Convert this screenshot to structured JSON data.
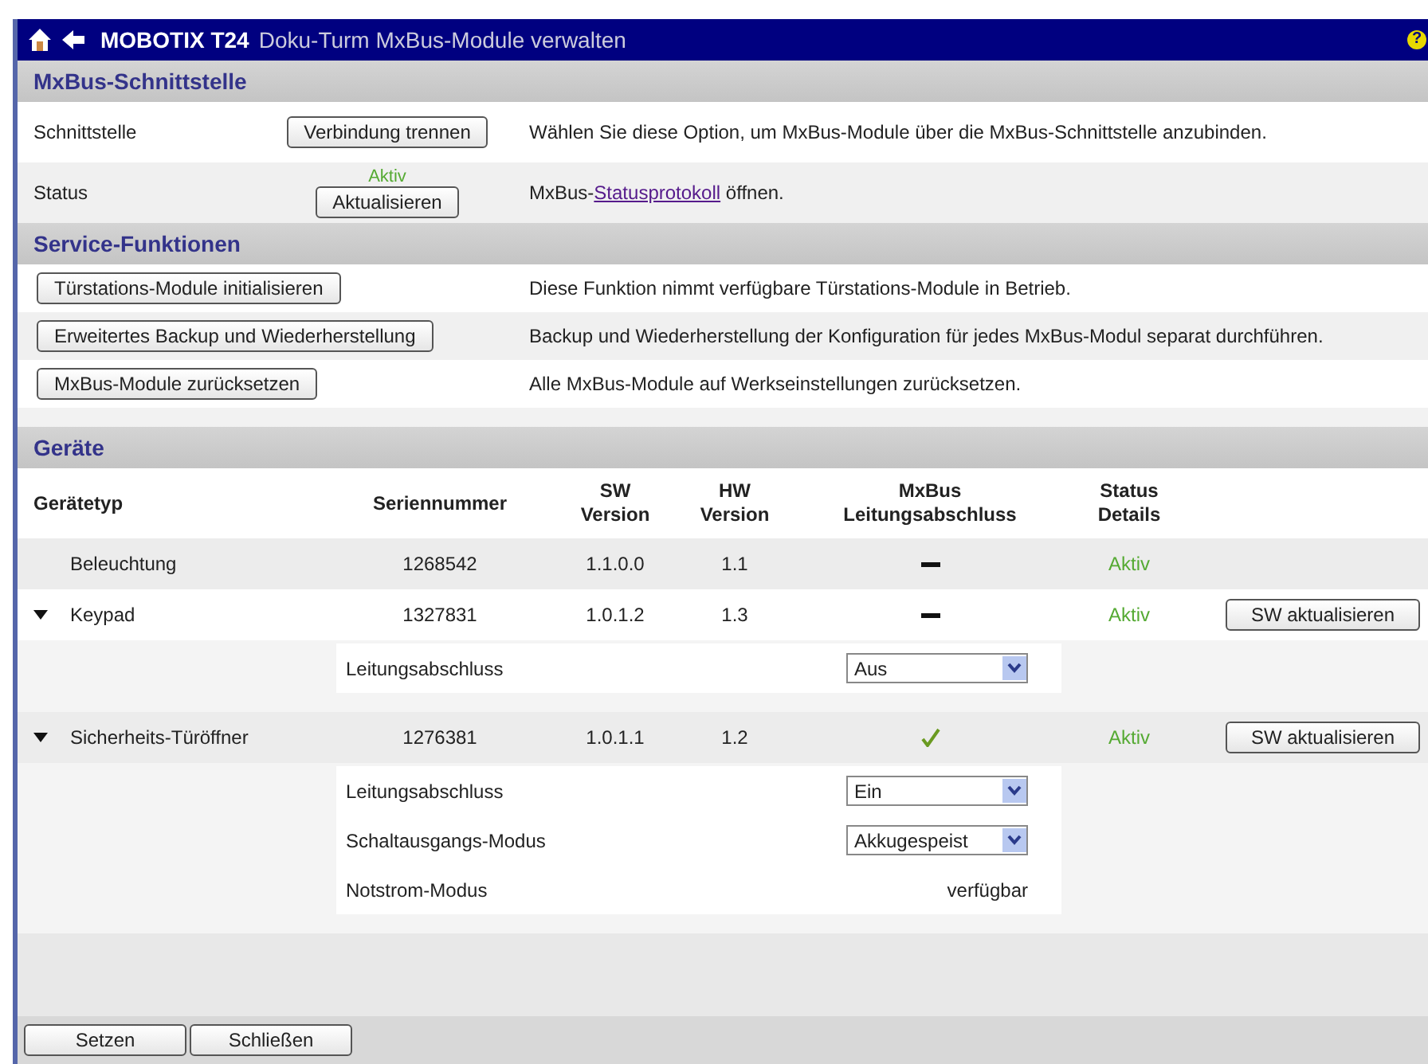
{
  "window": {
    "brand": "MOBOTIX T24",
    "title": "Doku-Turm MxBus-Module verwalten",
    "help": "?"
  },
  "interface": {
    "heading": "MxBus-Schnittstelle",
    "rows": [
      {
        "label": "Schnittstelle",
        "button": "Verbindung trennen",
        "text": "Wählen Sie diese Option, um MxBus-Module über die MxBus-Schnittstelle anzubinden."
      },
      {
        "label": "Status",
        "status": "Aktiv",
        "button": "Aktualisieren",
        "text_before": "MxBus-",
        "link": "Statusprotokoll",
        "text_after": " öffnen."
      }
    ]
  },
  "service": {
    "heading": "Service-Funktionen",
    "rows": [
      {
        "button": "Türstations-Module initialisieren",
        "text": "Diese Funktion nimmt verfügbare Türstations-Module in Betrieb."
      },
      {
        "button": "Erweitertes Backup und Wiederherstellung",
        "text": "Backup und Wiederherstellung der Konfiguration für jedes MxBus-Modul separat durchführen."
      },
      {
        "button": "MxBus-Module zurücksetzen",
        "text": "Alle MxBus-Module auf Werkseinstellungen zurücksetzen."
      }
    ]
  },
  "devices": {
    "heading": "Geräte",
    "columns": [
      [
        "Gerätetyp"
      ],
      [
        "Seriennummer"
      ],
      [
        "SW",
        "Version"
      ],
      [
        "HW",
        "Version"
      ],
      [
        "MxBus",
        "Leitungsabschluss"
      ],
      [
        "Status",
        "Details"
      ]
    ],
    "rows": [
      {
        "type": "Beleuchtung",
        "expanded": false,
        "serial": "1268542",
        "sw": "1.1.0.0",
        "hw": "1.1",
        "termination": {
          "kind": "dash"
        },
        "status": "Aktiv"
      },
      {
        "type": "Keypad",
        "expanded": true,
        "serial": "1327831",
        "sw": "1.0.1.2",
        "hw": "1.3",
        "termination": {
          "kind": "dash"
        },
        "status": "Aktiv",
        "button": "SW aktualisieren",
        "settings": [
          {
            "kind": "select",
            "label": "Leitungsabschluss",
            "value": "Aus"
          }
        ]
      },
      {
        "type": "Sicherheits-Türöffner",
        "expanded": true,
        "serial": "1276381",
        "sw": "1.0.1.1",
        "hw": "1.2",
        "termination": {
          "kind": "check"
        },
        "status": "Aktiv",
        "button": "SW aktualisieren",
        "settings": [
          {
            "kind": "select",
            "label": "Leitungsabschluss",
            "value": "Ein"
          },
          {
            "kind": "select",
            "label": "Schaltausgangs-Modus",
            "value": "Akkugespeist"
          },
          {
            "kind": "text",
            "label": "Notstrom-Modus",
            "value": "verfügbar"
          }
        ]
      }
    ]
  },
  "buttons": [
    "Setzen",
    "Schließen"
  ]
}
